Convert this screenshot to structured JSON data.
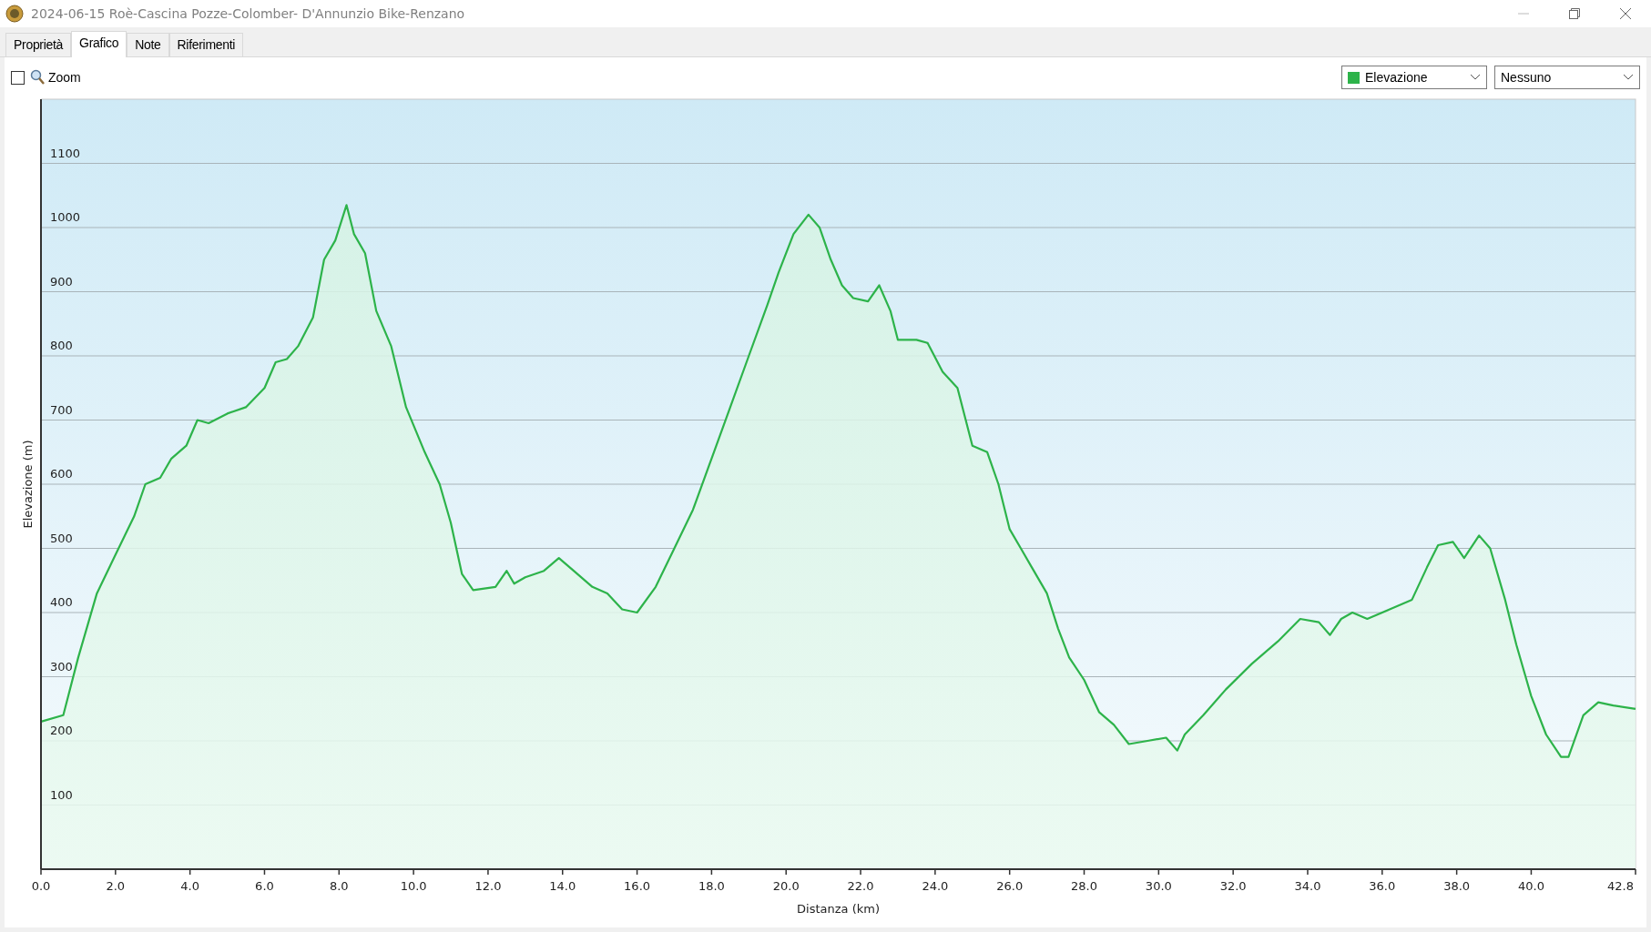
{
  "window": {
    "title": "2024-06-15 Roè-Cascina Pozze-Colomber- D'Annunzio Bike-Renzano"
  },
  "tabs": [
    {
      "label": "Proprietà",
      "selected": false
    },
    {
      "label": "Grafico",
      "selected": true
    },
    {
      "label": "Note",
      "selected": false
    },
    {
      "label": "Riferimenti",
      "selected": false
    }
  ],
  "toolbar": {
    "zoom": {
      "label": "Zoom",
      "checked": false
    },
    "series_dropdown": {
      "value": "Elevazione",
      "color": "#2db34a"
    },
    "compare_dropdown": {
      "value": "Nessuno"
    }
  },
  "chart_data": {
    "type": "area",
    "xlabel": "Distanza  (km)",
    "ylabel": "Elevazione (m)",
    "xlim": [
      0,
      42.8
    ],
    "ylim": [
      0,
      1200
    ],
    "xticks": [
      {
        "value": 0,
        "label": "0.0"
      },
      {
        "value": 2,
        "label": "2.0"
      },
      {
        "value": 4,
        "label": "4.0"
      },
      {
        "value": 6,
        "label": "6.0"
      },
      {
        "value": 8,
        "label": "8.0"
      },
      {
        "value": 10,
        "label": "10.0"
      },
      {
        "value": 12,
        "label": "12.0"
      },
      {
        "value": 14,
        "label": "14.0"
      },
      {
        "value": 16,
        "label": "16.0"
      },
      {
        "value": 18,
        "label": "18.0"
      },
      {
        "value": 20,
        "label": "20.0"
      },
      {
        "value": 22,
        "label": "22.0"
      },
      {
        "value": 24,
        "label": "24.0"
      },
      {
        "value": 26,
        "label": "26.0"
      },
      {
        "value": 28,
        "label": "28.0"
      },
      {
        "value": 30,
        "label": "30.0"
      },
      {
        "value": 32,
        "label": "32.0"
      },
      {
        "value": 34,
        "label": "34.0"
      },
      {
        "value": 36,
        "label": "36.0"
      },
      {
        "value": 38,
        "label": "38.0"
      },
      {
        "value": 40,
        "label": "40.0"
      },
      {
        "value": 42.8,
        "label": "42.8"
      }
    ],
    "yticks": [
      100,
      200,
      300,
      400,
      500,
      600,
      700,
      800,
      900,
      1000,
      1100
    ],
    "x": [
      0,
      0.6,
      1.0,
      1.5,
      2.0,
      2.5,
      2.8,
      3.2,
      3.5,
      3.9,
      4.2,
      4.5,
      5.0,
      5.5,
      6.0,
      6.3,
      6.6,
      6.9,
      7.3,
      7.6,
      7.9,
      8.2,
      8.4,
      8.7,
      9.0,
      9.4,
      9.8,
      10.3,
      10.7,
      11.0,
      11.3,
      11.6,
      12.2,
      12.5,
      12.7,
      13.0,
      13.5,
      13.9,
      14.3,
      14.8,
      15.2,
      15.6,
      16.0,
      16.5,
      17.0,
      17.5,
      18.0,
      18.5,
      19.0,
      19.5,
      19.8,
      20.2,
      20.6,
      20.9,
      21.2,
      21.5,
      21.8,
      22.2,
      22.5,
      22.8,
      23.0,
      23.5,
      23.8,
      24.2,
      24.6,
      25.0,
      25.4,
      25.7,
      26.0,
      26.3,
      26.6,
      27.0,
      27.3,
      27.6,
      28.0,
      28.4,
      28.8,
      29.2,
      29.7,
      30.2,
      30.5,
      30.7,
      31.2,
      31.8,
      32.5,
      33.2,
      33.8,
      34.3,
      34.6,
      34.9,
      35.2,
      35.6,
      36.2,
      36.8,
      37.2,
      37.5,
      37.9,
      38.2,
      38.6,
      38.9,
      39.3,
      39.6,
      40.0,
      40.4,
      40.8,
      41.0,
      41.4,
      41.8,
      42.2,
      42.8
    ],
    "grid": true,
    "series": [
      {
        "color": "#2db34a",
        "values": [
          230,
          240,
          330,
          430,
          490,
          550,
          600,
          610,
          640,
          660,
          700,
          695,
          710,
          720,
          750,
          790,
          795,
          815,
          860,
          950,
          980,
          1035,
          990,
          960,
          870,
          815,
          720,
          650,
          600,
          540,
          460,
          435,
          440,
          465,
          445,
          455,
          465,
          485,
          465,
          440,
          430,
          405,
          400,
          440,
          500,
          560,
          640,
          720,
          800,
          880,
          930,
          990,
          1020,
          1000,
          950,
          910,
          890,
          885,
          910,
          870,
          825,
          825,
          820,
          775,
          750,
          660,
          650,
          600,
          530,
          500,
          470,
          430,
          375,
          330,
          295,
          245,
          225,
          195,
          200,
          205,
          185,
          210,
          240,
          280,
          320,
          355,
          390,
          385,
          365,
          390,
          400,
          390,
          405,
          420,
          470,
          505,
          510,
          485,
          520,
          500,
          420,
          350,
          270,
          210,
          175,
          175,
          240,
          260,
          255,
          250
        ]
      }
    ]
  }
}
